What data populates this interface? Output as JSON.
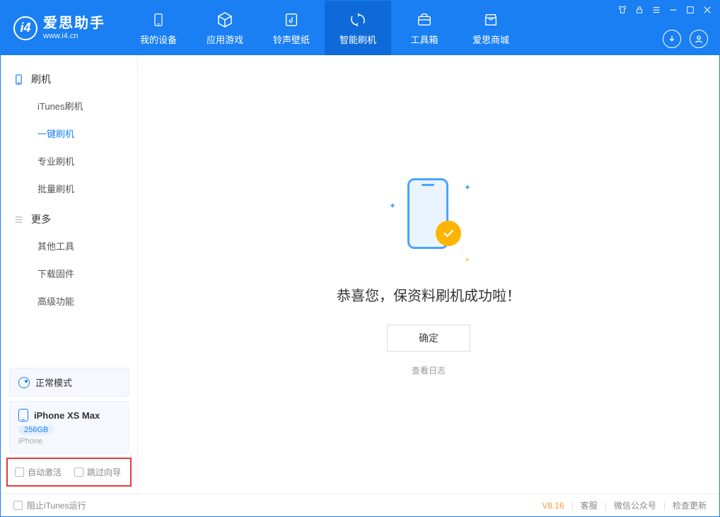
{
  "app": {
    "name": "爱思助手",
    "url": "www.i4.cn"
  },
  "nav": {
    "tabs": [
      {
        "label": "我的设备",
        "icon": "phone"
      },
      {
        "label": "应用游戏",
        "icon": "cube"
      },
      {
        "label": "铃声壁纸",
        "icon": "music"
      },
      {
        "label": "智能刷机",
        "icon": "refresh",
        "active": true
      },
      {
        "label": "工具箱",
        "icon": "briefcase"
      },
      {
        "label": "爱思商城",
        "icon": "shop"
      }
    ]
  },
  "sidebar": {
    "section1": {
      "title": "刷机",
      "items": [
        {
          "label": "iTunes刷机"
        },
        {
          "label": "一键刷机",
          "active": true
        },
        {
          "label": "专业刷机"
        },
        {
          "label": "批量刷机"
        }
      ]
    },
    "section2": {
      "title": "更多",
      "items": [
        {
          "label": "其他工具"
        },
        {
          "label": "下载固件"
        },
        {
          "label": "高级功能"
        }
      ]
    },
    "mode": {
      "label": "正常模式"
    },
    "device": {
      "name": "iPhone XS Max",
      "storage": "256GB",
      "type": "iPhone"
    },
    "options": {
      "auto_activate": "自动激活",
      "skip_guide": "跳过向导"
    }
  },
  "main": {
    "success_text": "恭喜您，保资料刷机成功啦！",
    "ok_button": "确定",
    "view_log": "查看日志"
  },
  "footer": {
    "block_itunes": "阻止iTunes运行",
    "version": "V8.16",
    "links": {
      "service": "客服",
      "wechat": "微信公众号",
      "update": "检查更新"
    }
  }
}
